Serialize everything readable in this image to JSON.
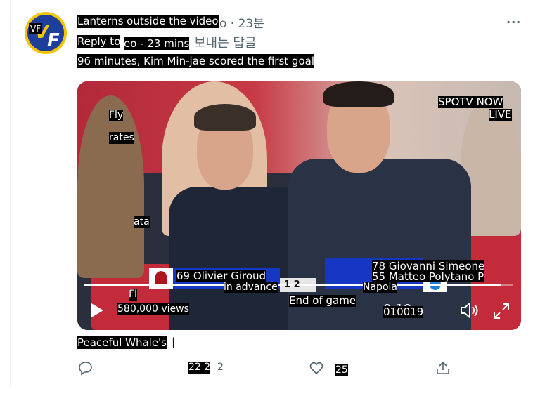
{
  "header": {
    "avatar_text": "VF",
    "author": "Lanterns outside the video",
    "author_ghost": "o · 23분",
    "reply_label": "Reply to",
    "reply_time": "eo - 23 mins",
    "reply_ghost": "보내는 답글",
    "tweet_text": "96 minutes, Kim Min-jae scored the first goal",
    "more_label": "···"
  },
  "video": {
    "broadcaster": "SPOTV NOW",
    "live_label": "LIVE",
    "overlay_fly": "Fly",
    "overlay_rates": "rates",
    "overlay_ata": "ata",
    "overlay_fi": "FI",
    "views": "580,000 views",
    "sub_left": "69 Olivier Giroud",
    "sub_right_1": "78 Giovanni Simeone",
    "sub_right_2": "55 Matteo Polytano P",
    "in_advance": "in advance",
    "score": "1  2",
    "team_right": "Napola",
    "end_label": "End of game",
    "time_label": "010019",
    "time_ghost": "0:19",
    "progress": 0.97
  },
  "footer": {
    "caption": "Peaceful Whale's",
    "reply_count": "22 2",
    "reply_ghost": "2",
    "like_count": "25"
  }
}
